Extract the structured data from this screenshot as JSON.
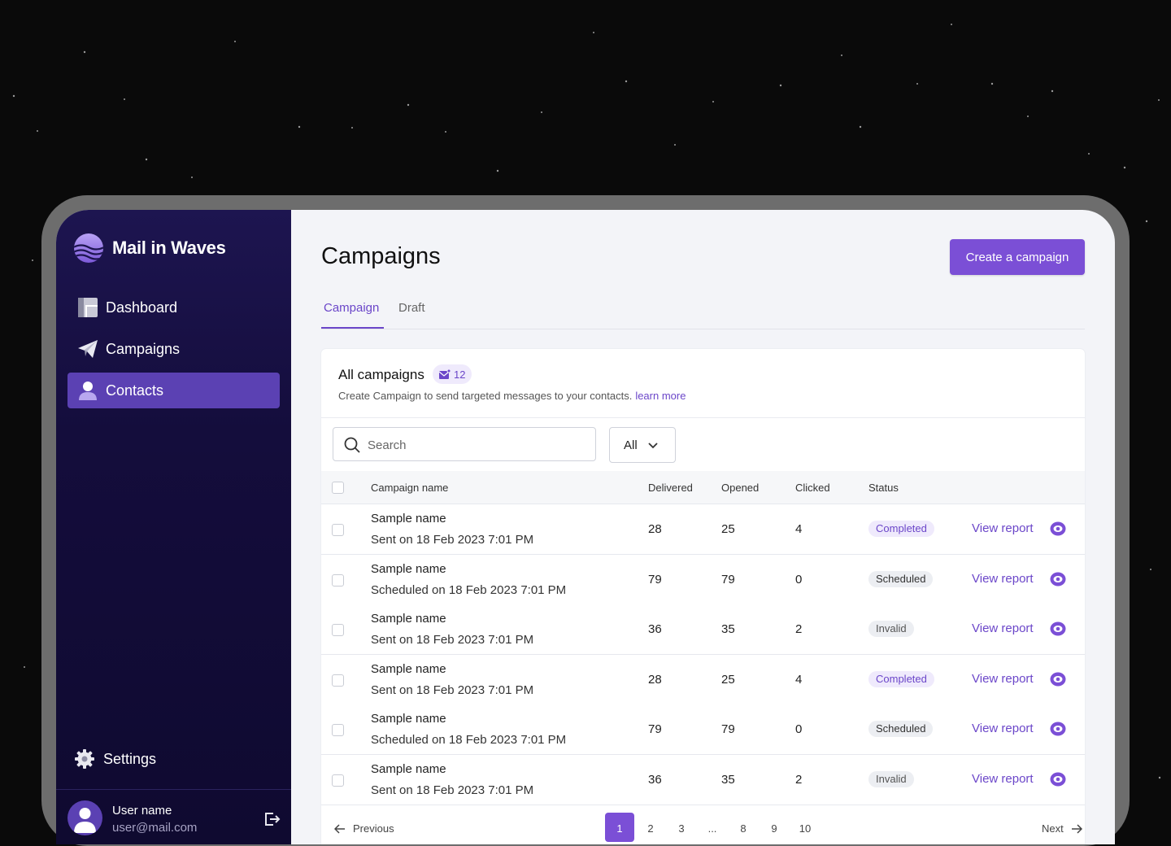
{
  "app": {
    "name": "Mail in Waves"
  },
  "sidebar": {
    "items": [
      {
        "label": "Dashboard",
        "icon": "dashboard-icon",
        "active": false
      },
      {
        "label": "Campaigns",
        "icon": "paper-plane-icon",
        "active": false
      },
      {
        "label": "Contacts",
        "icon": "user-icon",
        "active": true
      }
    ],
    "settings_label": "Settings",
    "user": {
      "name": "User name",
      "email": "user@mail.com"
    }
  },
  "header": {
    "title": "Campaigns",
    "create_label": "Create a campaign"
  },
  "tabs": [
    {
      "label": "Campaign",
      "active": true
    },
    {
      "label": "Draft",
      "active": false
    }
  ],
  "card": {
    "title": "All campaigns",
    "count": "12",
    "subtitle": "Create Campaign to send targeted messages to your contacts.",
    "learn_more": "learn more"
  },
  "search": {
    "placeholder": "Search"
  },
  "filter": {
    "selected": "All"
  },
  "table": {
    "columns": [
      "Campaign name",
      "Delivered",
      "Opened",
      "Clicked",
      "Status"
    ],
    "view_label": "View report",
    "rows": [
      {
        "name": "Sample name",
        "date": "Sent on 18 Feb 2023 7:01 PM",
        "delivered": "28",
        "opened": "25",
        "clicked": "4",
        "status": "Completed",
        "status_kind": "completed"
      },
      {
        "name": "Sample name",
        "date": "Scheduled on 18 Feb 2023 7:01 PM",
        "delivered": "79",
        "opened": "79",
        "clicked": "0",
        "status": "Scheduled",
        "status_kind": "scheduled"
      },
      {
        "name": "Sample name",
        "date": "Sent on 18 Feb 2023 7:01 PM",
        "delivered": "36",
        "opened": "35",
        "clicked": "2",
        "status": "Invalid",
        "status_kind": "invalid"
      },
      {
        "name": "Sample name",
        "date": "Sent on 18 Feb 2023 7:01 PM",
        "delivered": "28",
        "opened": "25",
        "clicked": "4",
        "status": "Completed",
        "status_kind": "completed"
      },
      {
        "name": "Sample name",
        "date": "Scheduled on 18 Feb 2023 7:01 PM",
        "delivered": "79",
        "opened": "79",
        "clicked": "0",
        "status": "Scheduled",
        "status_kind": "scheduled"
      },
      {
        "name": "Sample name",
        "date": "Sent on 18 Feb 2023 7:01 PM",
        "delivered": "36",
        "opened": "35",
        "clicked": "2",
        "status": "Invalid",
        "status_kind": "invalid"
      }
    ]
  },
  "pagination": {
    "prev_label": "Previous",
    "next_label": "Next",
    "pages": [
      "1",
      "2",
      "3",
      "...",
      "8",
      "9",
      "10"
    ],
    "current": "1"
  },
  "colors": {
    "accent": "#7b4fd6",
    "sidebar_bg": "#140d3c",
    "sidebar_active": "#5b41b3"
  }
}
